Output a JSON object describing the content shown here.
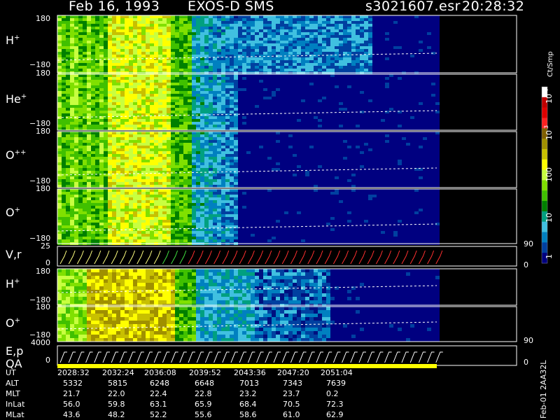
{
  "header": {
    "date": "Feb 16, 1993",
    "instrument": "EXOS-D SMS",
    "file": "s3021607.esr",
    "time": "20:28:32"
  },
  "colorbar": {
    "unit": "Ct/Smp",
    "labels": [
      "10",
      "4",
      "10",
      "3",
      "100",
      "10",
      "1"
    ],
    "colors": [
      "#ffffff",
      "#c00000",
      "#e00000",
      "#ff2020",
      "#806000",
      "#a09000",
      "#c8c000",
      "#ffff00",
      "#c8ff40",
      "#80e000",
      "#40c000",
      "#008000",
      "#00a080",
      "#40c0e0",
      "#0080c0",
      "#0040a0",
      "#000080"
    ]
  },
  "panels": [
    {
      "label": "H",
      "charge": "+",
      "top_tick": "180",
      "bottom_tick": "−180"
    },
    {
      "label": "He",
      "charge": "+",
      "top_tick": "180",
      "bottom_tick": "−180"
    },
    {
      "label": "O",
      "charge": "++",
      "top_tick": "180",
      "bottom_tick": "−180"
    },
    {
      "label": "O",
      "charge": "+",
      "top_tick": "180",
      "bottom_tick": "−180"
    },
    {
      "label": "V,r",
      "charge": "",
      "top_tick": "25",
      "bottom_tick": "0",
      "right_top": "90",
      "right_bottom": "0"
    },
    {
      "label": "H",
      "charge": "+",
      "top_tick": "180",
      "bottom_tick": "−180"
    },
    {
      "label": "O",
      "charge": "+",
      "top_tick": "180",
      "bottom_tick": "−180"
    },
    {
      "label": "E,p",
      "charge": "",
      "top_tick": "4000",
      "bottom_tick": "0",
      "right_top": "90",
      "right_bottom": "0"
    }
  ],
  "qa_label": "QA",
  "side_text": "Feb-01  2AA32L",
  "chart_data": {
    "type": "heatmap",
    "title": "Feb 16, 1993   EXOS-D SMS",
    "x_ticks": [
      "2028:32",
      "2032:24",
      "2036:08",
      "2039:52",
      "2043:36",
      "2047:20",
      "2051:04"
    ],
    "rows": [
      {
        "name": "UT",
        "values": [
          "2028:32",
          "2032:24",
          "2036:08",
          "2039:52",
          "2043:36",
          "2047:20",
          "2051:04"
        ]
      },
      {
        "name": "ALT",
        "values": [
          "5332",
          "5815",
          "6248",
          "6648",
          "7013",
          "7343",
          "7639"
        ]
      },
      {
        "name": "MLT",
        "values": [
          "21.7",
          "22.0",
          "22.4",
          "22.8",
          "23.2",
          "23.7",
          "0.2"
        ]
      },
      {
        "name": "InLat",
        "values": [
          "56.0",
          "59.8",
          "63.1",
          "65.9",
          "68.4",
          "70.5",
          "72.3"
        ]
      },
      {
        "name": "MLat",
        "values": [
          "43.6",
          "48.2",
          "52.2",
          "55.6",
          "58.6",
          "61.0",
          "62.9"
        ]
      }
    ],
    "y_range": [
      -180,
      180
    ],
    "colorscale": "log Ct/Smp 1–10^4"
  }
}
